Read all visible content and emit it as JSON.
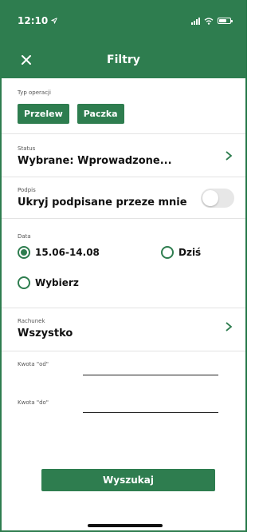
{
  "status_bar": {
    "time": "12:10"
  },
  "nav": {
    "title": "Filtry"
  },
  "operation_type": {
    "label": "Typ operacji",
    "chips": [
      "Przelew",
      "Paczka"
    ]
  },
  "status": {
    "label": "Status",
    "value": "Wybrane: Wprowadzone..."
  },
  "signature": {
    "label": "Podpis",
    "value": "Ukryj podpisane przeze mnie",
    "toggle_on": false
  },
  "date": {
    "label": "Data",
    "options": [
      "15.06-14.08",
      "Dziś",
      "Wybierz"
    ],
    "selected": "15.06-14.08"
  },
  "account": {
    "label": "Rachunek",
    "value": "Wszystko"
  },
  "amount_from": {
    "label": "Kwota \"od\"",
    "value": ""
  },
  "amount_to": {
    "label": "Kwota \"do\"",
    "value": ""
  },
  "actions": {
    "search_label": "Wyszukaj"
  },
  "colors": {
    "accent": "#2e7d4f",
    "toggle_off": "#e7e7e7"
  },
  "icons": {
    "close": "close-icon",
    "chevron": "chevron-right-icon",
    "location": "location-arrow-icon"
  }
}
